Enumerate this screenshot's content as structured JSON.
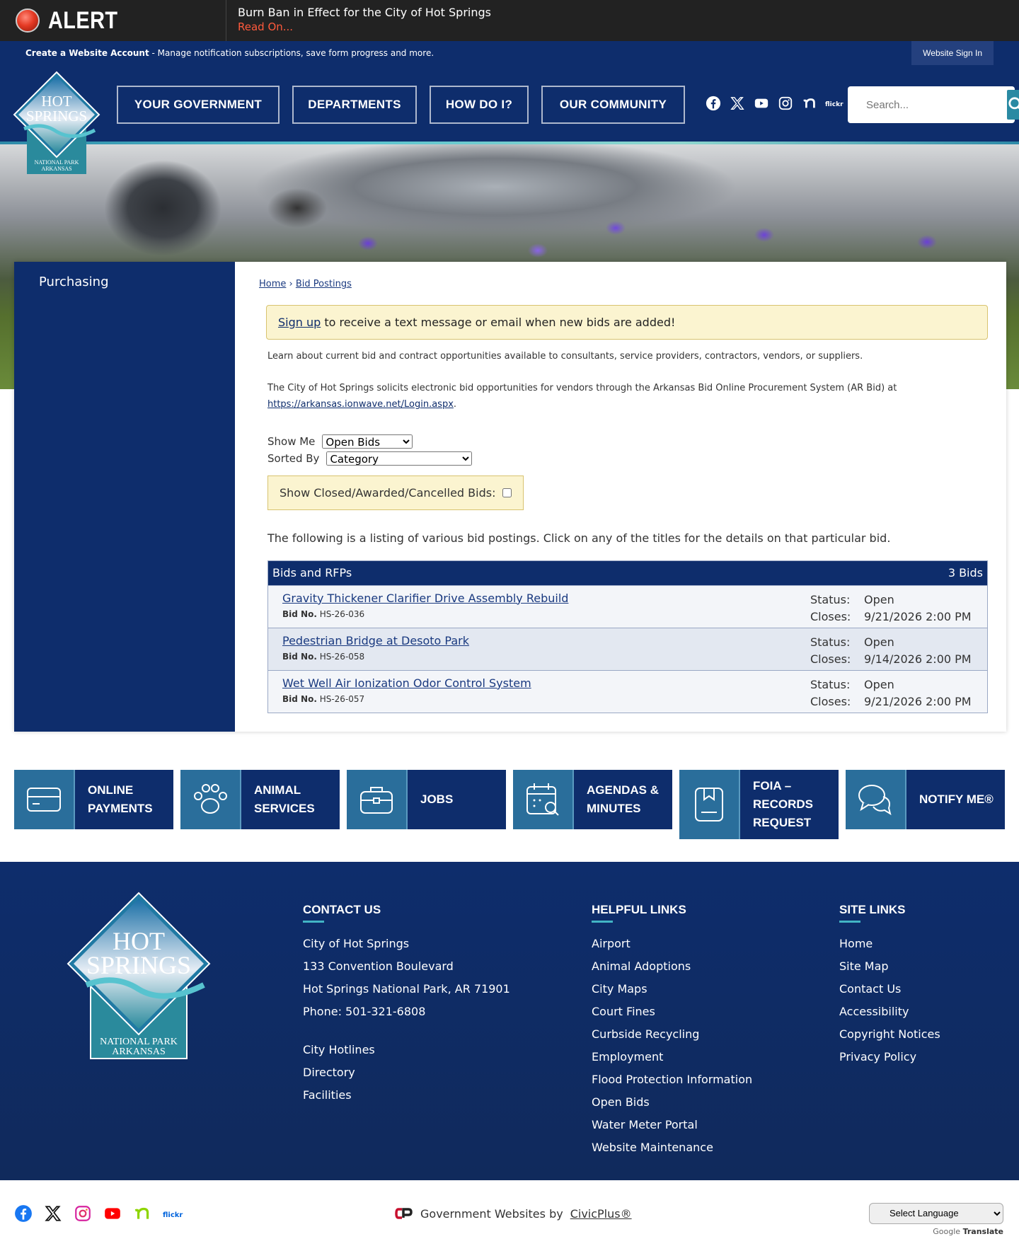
{
  "alert": {
    "word": "ALERT",
    "message": "Burn Ban in Effect for the City of Hot Springs",
    "link": "Read On..."
  },
  "account": {
    "create_label": "Create a Website Account",
    "create_desc": " - Manage notification subscriptions, save form progress and more.",
    "signin": "Website Sign In"
  },
  "logo": {
    "line1": "HOT",
    "line2": "SPRINGS",
    "line3": "NATIONAL PARK",
    "line4": "ARKANSAS"
  },
  "nav": {
    "items": [
      "YOUR GOVERNMENT",
      "DEPARTMENTS",
      "HOW DO I?",
      "OUR COMMUNITY"
    ]
  },
  "socials": [
    "facebook-icon",
    "x-icon",
    "youtube-icon",
    "instagram-icon",
    "nextdoor-icon",
    "flickr-icon"
  ],
  "flickr_label": "flickr",
  "search": {
    "placeholder": "Search..."
  },
  "sidebar": {
    "title": "Purchasing"
  },
  "breadcrumb": {
    "home": "Home",
    "sep": "›",
    "current": "Bid Postings"
  },
  "notice": {
    "link": "Sign up",
    "text": " to receive a text message or email when new bids are added!"
  },
  "intro": {
    "p1": "Learn about current bid and contract opportunities available to consultants, service providers, contractors, vendors, or suppliers.",
    "p2": "The City of Hot Springs solicits electronic bid opportunities for vendors through the Arkansas Bid Online Procurement System (AR Bid) at",
    "p2_link": "https://arkansas.ionwave.net/Login.aspx",
    "p2_end": "."
  },
  "filters": {
    "show_me_label": "Show Me",
    "show_me_value": "Open Bids",
    "sorted_by_label": "Sorted By",
    "sorted_by_value": "Category",
    "closed_label": "Show Closed/Awarded/Cancelled Bids:"
  },
  "listing_note": "The following is a listing of various bid postings. Click on any of the titles for the details on that particular bid.",
  "bids": {
    "header": "Bids and RFPs",
    "count": "3 Bids",
    "bid_no_label": "Bid No.",
    "status_label": "Status:",
    "closes_label": "Closes:",
    "rows": [
      {
        "title": "Gravity Thickener Clarifier Drive Assembly Rebuild",
        "bid_no": "HS-26-036",
        "status": "Open",
        "closes": "9/21/2026 2:00 PM"
      },
      {
        "title": "Pedestrian Bridge at Desoto Park",
        "bid_no": "HS-26-058",
        "status": "Open",
        "closes": "9/14/2026 2:00 PM"
      },
      {
        "title": "Wet Well Air Ionization Odor Control System",
        "bid_no": "HS-26-057",
        "status": "Open",
        "closes": "9/21/2026 2:00 PM"
      }
    ]
  },
  "quick_links": [
    {
      "line1": "ONLINE",
      "line2": "PAYMENTS",
      "line3": "",
      "icon": "card-icon"
    },
    {
      "line1": "ANIMAL",
      "line2": "SERVICES",
      "line3": "",
      "icon": "paw-icon"
    },
    {
      "line1": "JOBS",
      "line2": "",
      "line3": "",
      "icon": "briefcase-icon"
    },
    {
      "line1": "AGENDAS &",
      "line2": "MINUTES",
      "line3": "",
      "icon": "calendar-search-icon"
    },
    {
      "line1": "FOIA –",
      "line2": "RECORDS",
      "line3": "REQUEST",
      "icon": "document-icon"
    },
    {
      "line1": "NOTIFY ME®",
      "line2": "",
      "line3": "",
      "icon": "chat-icon"
    }
  ],
  "footer": {
    "contact": {
      "heading": "CONTACT US",
      "items": [
        "City of Hot Springs",
        "133 Convention Boulevard",
        "Hot Springs National Park, AR 71901",
        "Phone: 501-321-6808"
      ],
      "links": [
        "City Hotlines",
        "Directory",
        "Facilities"
      ]
    },
    "helpful": {
      "heading": "HELPFUL LINKS",
      "items": [
        "Airport",
        "Animal Adoptions",
        "City Maps",
        "Court Fines",
        "Curbside Recycling",
        "Employment",
        "Flood Protection Information",
        "Open Bids",
        "Water Meter Portal",
        "Website Maintenance"
      ]
    },
    "site": {
      "heading": "SITE LINKS",
      "items": [
        "Home",
        "Site Map",
        "Contact Us",
        "Accessibility",
        "Copyright Notices",
        "Privacy Policy"
      ]
    }
  },
  "bottom": {
    "civic_text": "Government Websites by ",
    "civic_link": "CivicPlus®",
    "language": "Select Language",
    "powered": "Google",
    "translate": "Translate"
  },
  "colors": {
    "navy": "#0e2d6c",
    "teal": "#2a8aa3",
    "alert_red": "#ff5a3c",
    "notice_bg": "#fbf4d0"
  }
}
